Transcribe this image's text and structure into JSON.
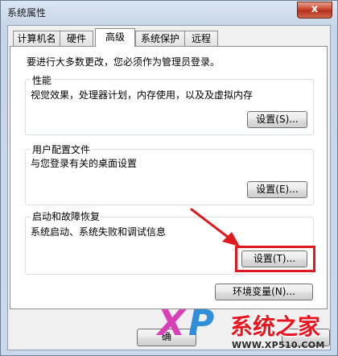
{
  "window": {
    "title": "系统属性",
    "close_glyph": "x"
  },
  "tabs": [
    {
      "label": "计算机名"
    },
    {
      "label": "硬件"
    },
    {
      "label": "高级",
      "active": true
    },
    {
      "label": "系统保护"
    },
    {
      "label": "远程"
    }
  ],
  "panel": {
    "admin_note": "要进行大多数更改，您必须作为管理员登录。",
    "performance": {
      "label": "性能",
      "description": "视觉效果，处理器计划，内存使用，以及及虚拟内存",
      "button": "设置(S)..."
    },
    "user_profiles": {
      "label": "用户配置文件",
      "description": "与您登录有关的桌面设置",
      "button": "设置(E)..."
    },
    "startup_recovery": {
      "label": "启动和故障恢复",
      "description": "系统启动、系统失败和调试信息",
      "button": "设置(T)..."
    },
    "env_button": "环境变量(N)..."
  },
  "footer": {
    "ok_partial": "确"
  },
  "watermark": {
    "x": "X",
    "p": "P",
    "brand": "系统之家",
    "url": "WWW.XP510.COM"
  },
  "colors": {
    "highlight": "#e0191f",
    "arrow": "#e0191f"
  }
}
